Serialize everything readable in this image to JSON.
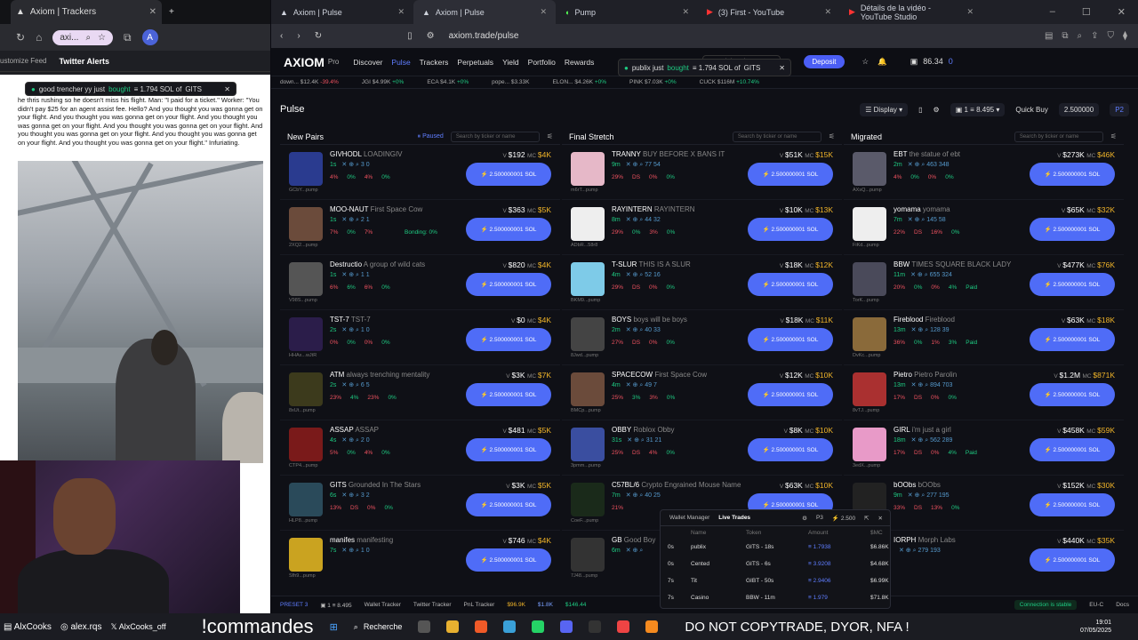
{
  "left_window": {
    "tab_title": "Axiom | Trackers",
    "url": "axi...",
    "bookmarks": [
      "ustomize Feed",
      "Twitter Alerts"
    ],
    "toast": {
      "user": "good trencher yy just",
      "action": "bought",
      "amount": "≡ 1.794 SOL of",
      "token": "GITS"
    },
    "tweet_text": "he thris rushing so he doesn't miss his flight. Man: \"I paid for a ticket.\" Worker: \"You didn't pay $25 for an agent assist fee. Hello? And you thought you was gonna get on your flight. And you thought you was gonna get on your flight. And you thought you was gonna get on your flight. And you thought you was gonna get on your flight. And you thought you was gonna get on your flight. And you thought you was gonna get on your flight. And you thought you was gonna get on your flight.\" Infuriating."
  },
  "main_window": {
    "tabs": [
      {
        "label": "Axiom | Pulse"
      },
      {
        "label": "Axiom | Pulse"
      },
      {
        "label": "Pump"
      },
      {
        "label": "(3) First - YouTube"
      },
      {
        "label": "Détails de la vidéo - YouTube Studio"
      }
    ],
    "url": "axiom.trade/pulse",
    "nav": {
      "logo": "AXIOM",
      "logo_sub": "Pro",
      "items": [
        "Discover",
        "Pulse",
        "Trackers",
        "Perpetuals",
        "Yield",
        "Portfolio",
        "Rewards"
      ],
      "search_placeholder": "Search by token or CA...",
      "deposit": "Deposit",
      "balance": "86.34",
      "count": "0"
    },
    "strip": [
      {
        "t": "down...",
        "v": "$12.4K",
        "c": "-39.4%"
      },
      {
        "t": "JGI",
        "v": "$4.99K",
        "c": "+0%"
      },
      {
        "t": "ECA",
        "v": "$4.1K",
        "c": "+0%"
      },
      {
        "t": "pope...",
        "v": "$3.33K",
        "c": ""
      },
      {
        "t": "ELON...",
        "v": "$4.26K",
        "c": "+0%"
      },
      {
        "t": "PINK",
        "v": "$7.03K",
        "c": "+0%"
      },
      {
        "t": "CUCK",
        "v": "$116M",
        "c": "+10.74%"
      }
    ],
    "toast": {
      "user": "publix just",
      "action": "bought",
      "amount": "≡ 1.794 SOL of",
      "token": "GITS"
    },
    "pulse": {
      "title": "Pulse",
      "display": "Display",
      "one": "1",
      "balance": "8.495",
      "quick_buy": "Quick Buy",
      "quick_val": "2.500000",
      "preset": "P2"
    },
    "columns": [
      {
        "title": "New Pairs",
        "paused": "Paused",
        "search": "Search by ticker or name",
        "rows": [
          {
            "sym": "GIVHODL",
            "name": "LOADINGIV",
            "ca": "GCbY...pump",
            "age": "1s",
            "icons": "3  0",
            "v": "$192",
            "mc": "$4K",
            "stats": [
              "4%",
              "0%",
              "4%",
              "0%"
            ],
            "color": "#2a3b8f"
          },
          {
            "sym": "MOO-NAUT",
            "name": "First Space Cow",
            "ca": "2XQ2...pump",
            "age": "1s",
            "icons": "2  1",
            "v": "$363",
            "mc": "$5K",
            "stats": [
              "7%",
              "0%",
              "7%"
            ],
            "bond": "Bonding: 0%",
            "color": "#6b4b3b"
          },
          {
            "sym": "Destructio",
            "name": "A group of wild cats",
            "ca": "V98S...pump",
            "age": "1s",
            "icons": "1  1",
            "v": "$820",
            "mc": "$4K",
            "stats": [
              "6%",
              "6%",
              "6%",
              "0%"
            ],
            "color": "#555"
          },
          {
            "sym": "TST-7",
            "name": "TST-7",
            "ca": "HHAx...wJtR",
            "age": "2s",
            "icons": "1  0",
            "v": "$0",
            "mc": "$4K",
            "stats": [
              "0%",
              "0%",
              "0%",
              "0%"
            ],
            "color": "#2b1d4a"
          },
          {
            "sym": "ATM",
            "name": "always trenching mentality",
            "ca": "8xUt...pump",
            "age": "2s",
            "icons": "6  5",
            "v": "$3K",
            "mc": "$7K",
            "stats": [
              "23%",
              "4%",
              "23%",
              "0%"
            ],
            "color": "#3c3a1c"
          },
          {
            "sym": "ASSAP",
            "name": "ASSAP",
            "ca": "CTP4...pump",
            "age": "4s",
            "icons": "2  0",
            "v": "$481",
            "mc": "$5K",
            "stats": [
              "5%",
              "0%",
              "4%",
              "0%"
            ],
            "color": "#7a1a1a"
          },
          {
            "sym": "GITS",
            "name": "Grounded In The Stars",
            "ca": "HLP8...pump",
            "age": "6s",
            "icons": "3  2",
            "v": "$3K",
            "mc": "$5K",
            "stats": [
              "13%",
              "DS",
              "0%",
              "0%"
            ],
            "color": "#2a4a5a"
          },
          {
            "sym": "manifes",
            "name": "manifesting",
            "ca": "Sfh9...pump",
            "age": "7s",
            "icons": "1  0",
            "v": "$746",
            "mc": "$4K",
            "stats": [],
            "color": "#caa320"
          }
        ]
      },
      {
        "title": "Final Stretch",
        "search": "Search by ticker or name",
        "rows": [
          {
            "sym": "TRANNY",
            "name": "BUY BEFORE X BANS IT",
            "ca": "m6rT...pump",
            "age": "9m",
            "icons": "77  54",
            "v": "$51K",
            "mc": "$15K",
            "stats": [
              "29%",
              "DS",
              "0%",
              "0%"
            ],
            "color": "#e6b8c8"
          },
          {
            "sym": "RAYINTERN",
            "name": "RAYINTERN",
            "ca": "ADbR...58r8",
            "age": "8m",
            "icons": "44  32",
            "v": "$10K",
            "mc": "$13K",
            "stats": [
              "29%",
              "0%",
              "3%",
              "0%"
            ],
            "color": "#eee"
          },
          {
            "sym": "T-SLUR",
            "name": "THIS IS A SLUR",
            "ca": "BKM9...pump",
            "age": "4m",
            "icons": "52  16",
            "v": "$18K",
            "mc": "$12K",
            "stats": [
              "29%",
              "DS",
              "0%",
              "0%"
            ],
            "color": "#7ecbe8"
          },
          {
            "sym": "BOYS",
            "name": "boys will be boys",
            "ca": "8Jwd...pump",
            "age": "2m",
            "icons": "40  33",
            "v": "$18K",
            "mc": "$11K",
            "stats": [
              "27%",
              "DS",
              "0%",
              "0%"
            ],
            "color": "#444"
          },
          {
            "sym": "SPACECOW",
            "name": "First Space Cow",
            "ca": "BMCp...pump",
            "age": "4m",
            "icons": "49  7",
            "v": "$12K",
            "mc": "$10K",
            "stats": [
              "25%",
              "3%",
              "3%",
              "0%"
            ],
            "color": "#6b4b3b"
          },
          {
            "sym": "OBBY",
            "name": "Roblox Obby",
            "ca": "3pmm...pump",
            "age": "31s",
            "icons": "31  21",
            "v": "$8K",
            "mc": "$10K",
            "stats": [
              "25%",
              "DS",
              "4%",
              "0%"
            ],
            "color": "#3a4ea0"
          },
          {
            "sym": "C57BL/6",
            "name": "Crypto Engrained Mouse Name",
            "ca": "CoeF...pump",
            "age": "7m",
            "icons": "40  25",
            "v": "$63K",
            "mc": "$10K",
            "stats": [
              "21%"
            ],
            "color": "#1a2a1a"
          },
          {
            "sym": "GB",
            "name": "Good Boy",
            "ca": "7J48...pump",
            "age": "6m",
            "icons": "",
            "v": "",
            "mc": "",
            "stats": [],
            "color": "#333"
          }
        ]
      },
      {
        "title": "Migrated",
        "search": "Search by ticker or name",
        "rows": [
          {
            "sym": "EBT",
            "name": "the statue of ebt",
            "ca": "AXsQ...pump",
            "age": "2m",
            "icons": "463  348",
            "v": "$273K",
            "mc": "$46K",
            "stats": [
              "4%",
              "0%",
              "0%",
              "0%"
            ],
            "color": "#5a5a6a"
          },
          {
            "sym": "yomama",
            "name": "yomama",
            "ca": "FiKd...pump",
            "age": "7m",
            "icons": "145  58",
            "v": "$65K",
            "mc": "$32K",
            "stats": [
              "22%",
              "DS",
              "16%",
              "0%"
            ],
            "color": "#eee"
          },
          {
            "sym": "BBW",
            "name": "TIMES SQUARE BLACK LADY",
            "ca": "TorK...pump",
            "age": "11m",
            "icons": "655  324",
            "v": "$477K",
            "mc": "$76K",
            "stats": [
              "20%",
              "0%",
              "0%",
              "4%"
            ],
            "paid": "Paid",
            "color": "#4a4a5a"
          },
          {
            "sym": "Fireblood",
            "name": "Fireblood",
            "ca": "DvKc...pump",
            "age": "13m",
            "icons": "128  39",
            "v": "$63K",
            "mc": "$18K",
            "stats": [
              "36%",
              "0%",
              "1%",
              "3%"
            ],
            "paid": "Paid",
            "color": "#8a6a3a"
          },
          {
            "sym": "Pietro",
            "name": "Pietro Parolin",
            "ca": "8vTJ...pump",
            "age": "13m",
            "icons": "894  703",
            "v": "$1.2M",
            "mc": "$871K",
            "stats": [
              "17%",
              "DS",
              "0%",
              "0%"
            ],
            "color": "#aa3030"
          },
          {
            "sym": "GIRL",
            "name": "i'm just a girl",
            "ca": "3edX...pump",
            "age": "18m",
            "icons": "562  289",
            "v": "$458K",
            "mc": "$59K",
            "stats": [
              "17%",
              "DS",
              "0%",
              "4%"
            ],
            "paid": "Paid",
            "color": "#e89ac8"
          },
          {
            "sym": "bOObs",
            "name": "bOObs",
            "ca": "",
            "age": "9m",
            "icons": "277  195",
            "v": "$152K",
            "mc": "$30K",
            "stats": [
              "33%",
              "DS",
              "13%",
              "0%"
            ],
            "color": "#222"
          },
          {
            "sym": "IORPH",
            "name": "Morph Labs",
            "ca": "",
            "age": "",
            "icons": "279  193",
            "v": "$440K",
            "mc": "$35K",
            "stats": [],
            "color": "#222"
          }
        ]
      }
    ],
    "buy_label": "⚡ 2.500000001 SOL",
    "live_trades": {
      "tab1": "Wallet Manager",
      "tab2": "Live Trades",
      "preset": "P3",
      "amt": "2.500",
      "headers": [
        "",
        "Name",
        "Token",
        "Amount",
        "$MC"
      ],
      "rows": [
        {
          "t": "0s",
          "name": "publix",
          "token": "GITS - 18s",
          "amount": "1.7938",
          "mc": "$6.86K"
        },
        {
          "t": "0s",
          "name": "Cented",
          "token": "GITS - 6s",
          "amount": "3.9208",
          "mc": "$4.68K"
        },
        {
          "t": "7s",
          "name": "Tit",
          "token": "GIBT - 50s",
          "amount": "2.9406",
          "mc": "$6.99K"
        },
        {
          "t": "7s",
          "name": "Casino",
          "token": "BBW - 11m",
          "amount": "1.979",
          "mc": "$71.8K"
        }
      ]
    },
    "footer": {
      "preset": "PRESET 3",
      "one": "1",
      "bal": "8.495",
      "items": [
        "Wallet Tracker",
        "Twitter Tracker",
        "PnL Tracker"
      ],
      "btc": "$96.9K",
      "eth": "$1.8K",
      "sol": "$146.44",
      "conn": "Connection is stable",
      "region": "EU-C",
      "docs": "Docs"
    }
  },
  "taskbar": {
    "user": "AlxCooks",
    "ig": "alex.rqs",
    "x": "AlxCooks_off",
    "cmd": "!commandes",
    "search": "Recherche",
    "warning": "DO NOT COPYTRADE, DYOR, NFA !",
    "time": "19:01",
    "date": "07/05/2025"
  }
}
